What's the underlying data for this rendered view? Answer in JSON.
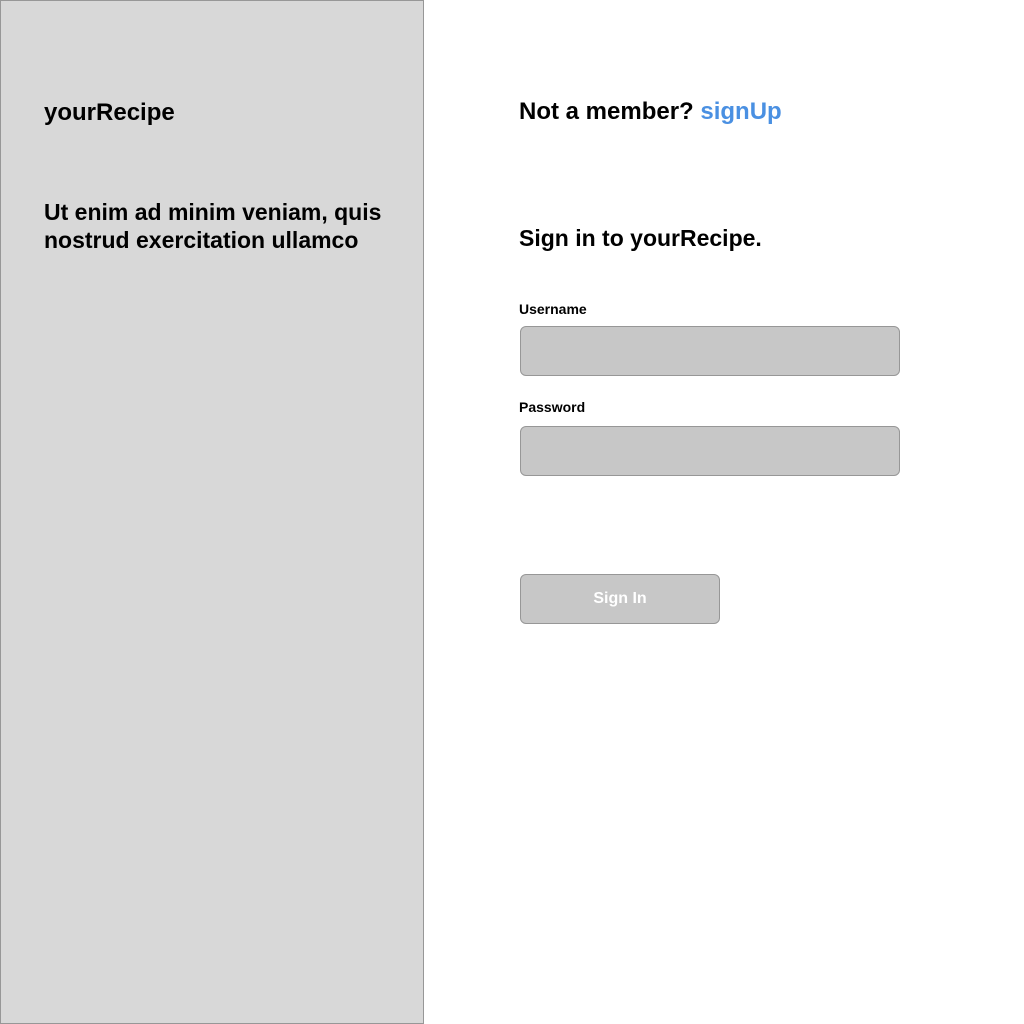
{
  "left_panel": {
    "brand": "yourRecipe",
    "tagline": "Ut enim ad minim veniam, quis nostrud exercitation ullamco"
  },
  "header": {
    "member_prompt": "Not a member?",
    "signup_link": "signUp"
  },
  "form": {
    "title": "Sign in to yourRecipe.",
    "username_label": "Username",
    "username_value": "",
    "password_label": "Password",
    "password_value": "",
    "submit_label": "Sign In"
  },
  "colors": {
    "panel_background": "#d8d8d8",
    "input_background": "#c7c7c7",
    "link": "#4a90e2",
    "border": "#979797"
  }
}
